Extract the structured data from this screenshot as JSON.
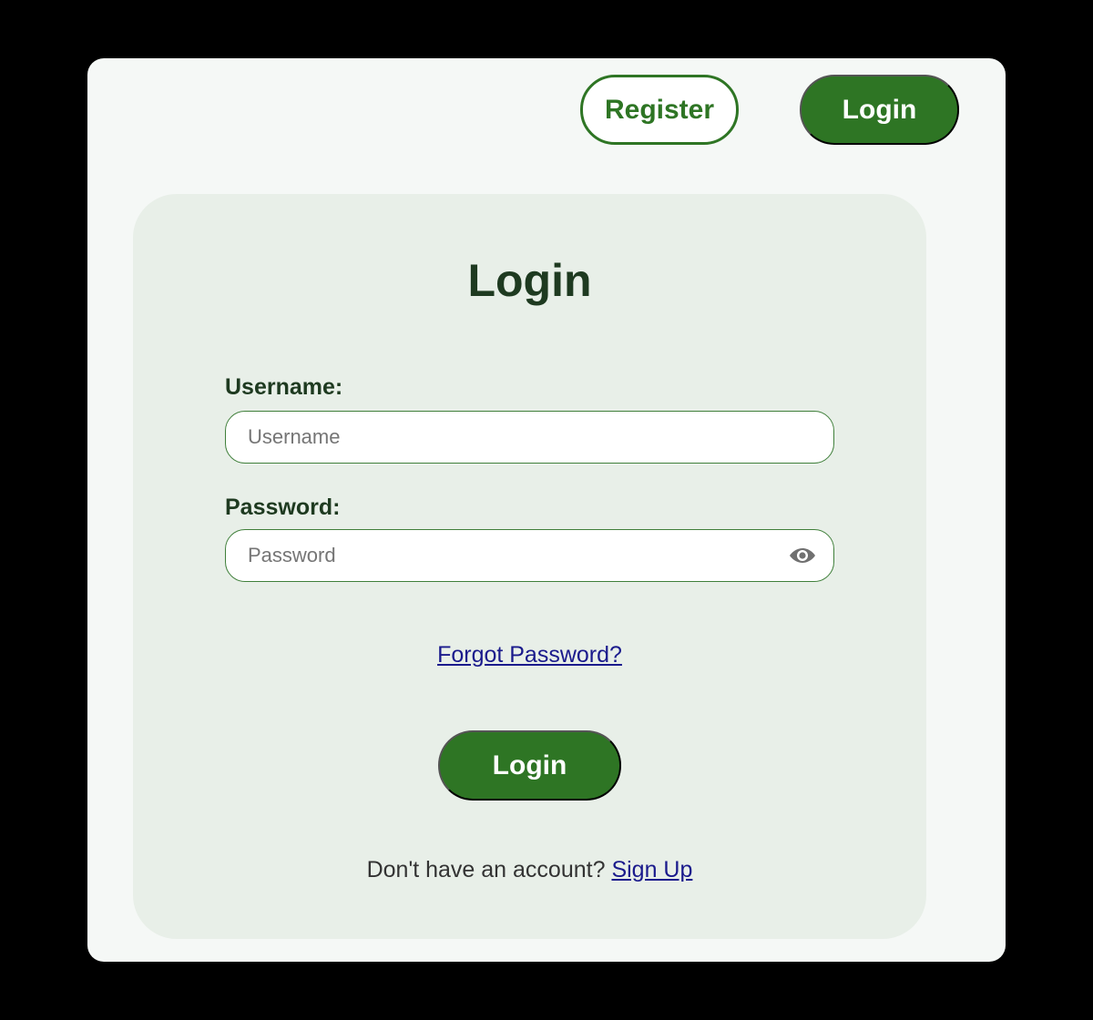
{
  "header": {
    "register_label": "Register",
    "login_label": "Login"
  },
  "card": {
    "title": "Login",
    "username": {
      "label": "Username:",
      "placeholder": "Username",
      "value": ""
    },
    "password": {
      "label": "Password:",
      "placeholder": "Password",
      "value": "",
      "toggle_icon": "eye-icon"
    },
    "forgot_password_label": "Forgot Password?",
    "login_button_label": "Login",
    "signup_prompt": "Don't have an account?",
    "signup_link_label": "Sign Up"
  },
  "colors": {
    "page_background": "#000000",
    "window_background": "#f5f8f6",
    "card_background": "#e8efe8",
    "brand_green": "#2e7524",
    "heading_text": "#1e3a20",
    "link": "#1a1a8c"
  }
}
